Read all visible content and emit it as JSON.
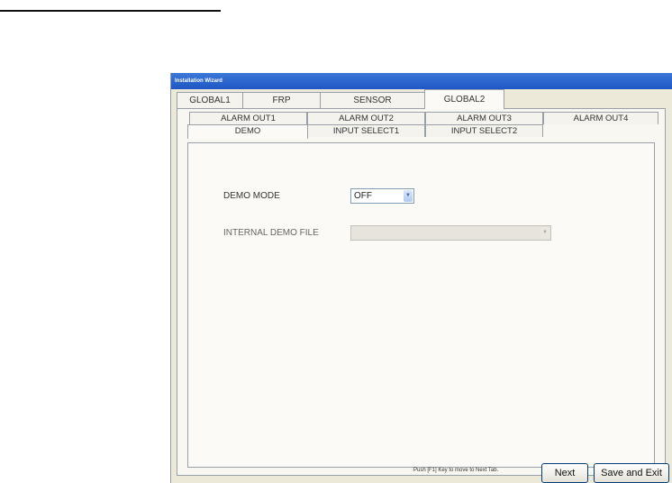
{
  "window": {
    "title": "Installation Wizard"
  },
  "main_tabs": [
    "GLOBAL1",
    "FRP",
    "SENSOR",
    "GLOBAL2"
  ],
  "sub_tabs_row1": [
    "ALARM OUT1",
    "ALARM OUT2",
    "ALARM OUT3",
    "ALARM OUT4"
  ],
  "sub_tabs_row2": [
    "DEMO",
    "INPUT SELECT1",
    "INPUT SELECT2"
  ],
  "form": {
    "demo_mode_label": "DEMO MODE",
    "demo_mode_value": "OFF",
    "internal_demo_file_label": "INTERNAL DEMO FILE",
    "internal_demo_file_value": ""
  },
  "footer": {
    "hint": "Push [F1] Key to move to Next Tab.",
    "next_label": "Next",
    "save_exit_label": "Save and Exit"
  },
  "icons": {
    "dropdown": "chevron-down-icon"
  }
}
